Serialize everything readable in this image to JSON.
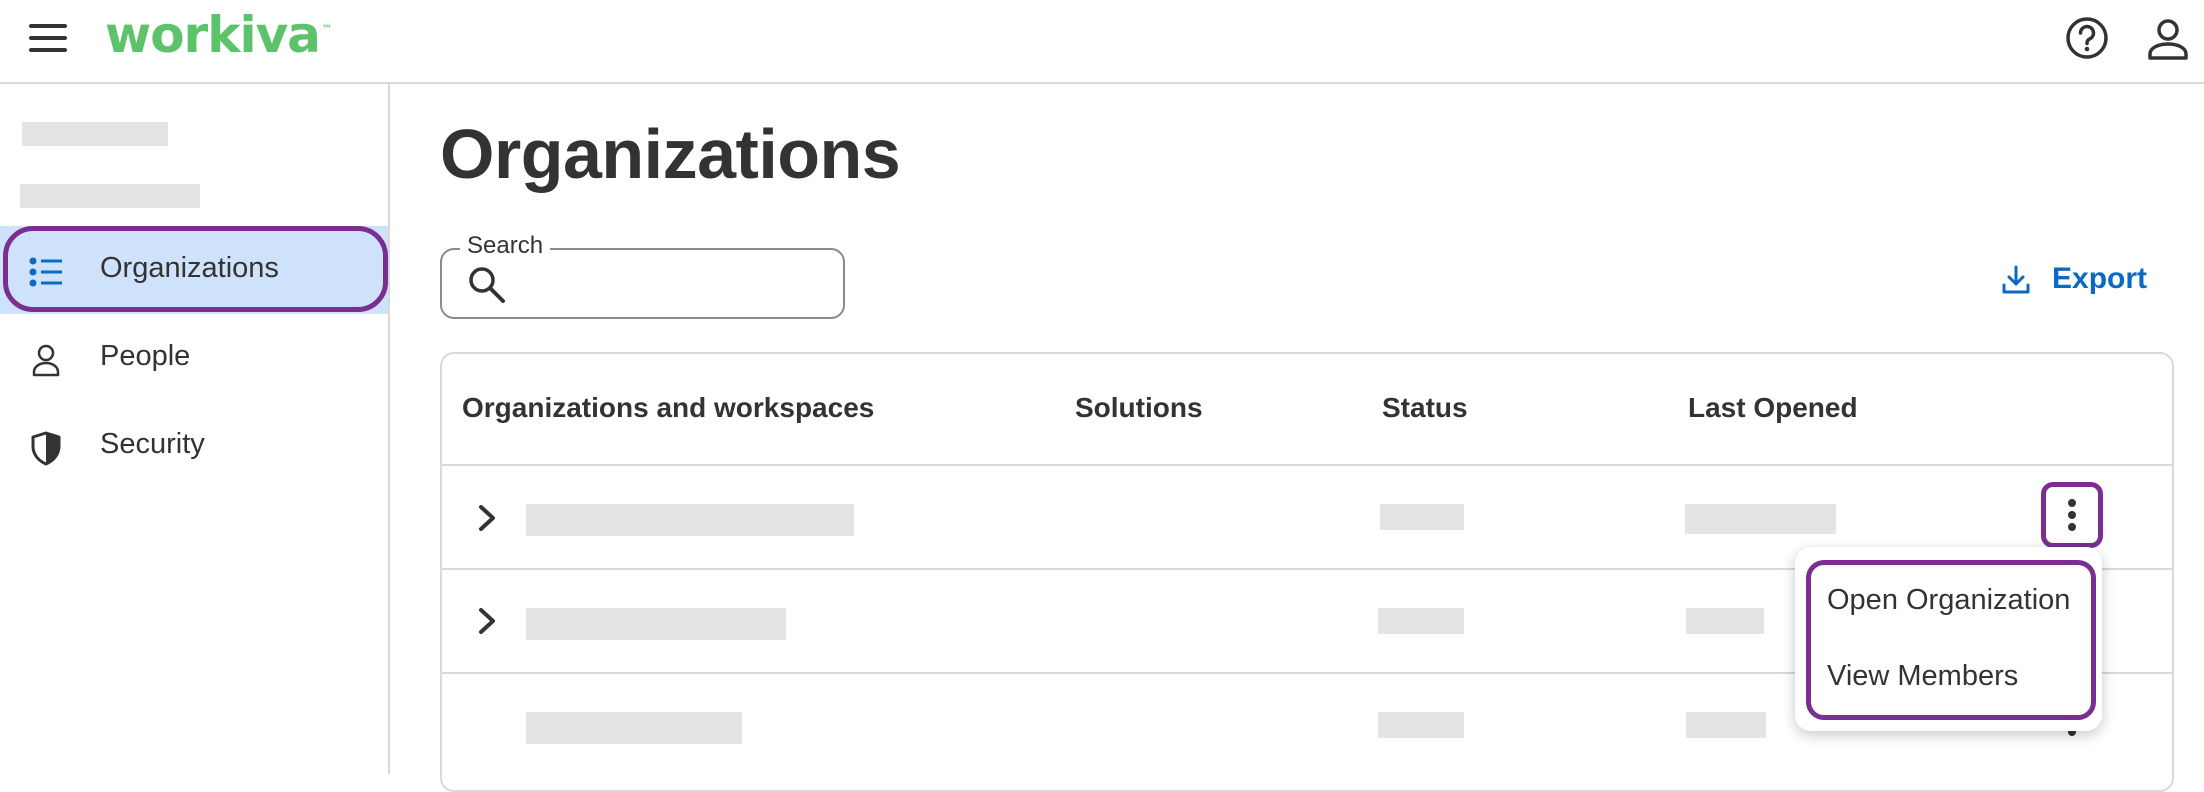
{
  "app": {
    "logo_text": "workiva",
    "logo_color": "#5cc36a",
    "header_icons": [
      "help-circle-icon",
      "user-icon"
    ]
  },
  "sidebar": {
    "items": [
      {
        "label": "Organizations",
        "icon": "list-icon",
        "active": true
      },
      {
        "label": "People",
        "icon": "person-icon",
        "active": false
      },
      {
        "label": "Security",
        "icon": "shield-icon",
        "active": false
      }
    ],
    "active_bg": "#cfe2fb",
    "highlight_color": "#7a2e91"
  },
  "main": {
    "title": "Organizations",
    "search": {
      "label": "Search",
      "value": ""
    },
    "export": {
      "label": "Export",
      "icon": "download-icon",
      "color": "#0b6bc2"
    }
  },
  "table": {
    "columns": [
      "Organizations and workspaces",
      "Solutions",
      "Status",
      "Last Opened"
    ],
    "rows": [
      {
        "expandable": true,
        "has_actions": true
      },
      {
        "expandable": true,
        "has_actions": false
      },
      {
        "expandable": false,
        "has_actions": true
      }
    ]
  },
  "row_menu": {
    "items": [
      "Open Organization",
      "View Members"
    ]
  }
}
